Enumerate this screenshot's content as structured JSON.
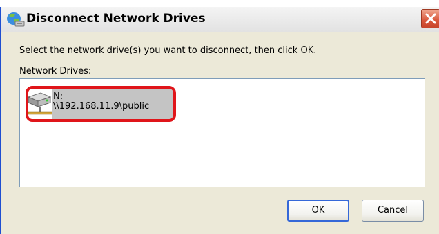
{
  "window": {
    "title": "Disconnect Network Drives"
  },
  "dialog": {
    "instruction": "Select the network drive(s) you want to disconnect, then click OK.",
    "list_label": "Network Drives:",
    "drives": [
      {
        "letter": "N:",
        "path": "\\\\192.168.11.9\\public",
        "selected": true,
        "highlighted": true
      }
    ]
  },
  "buttons": {
    "ok_label": "OK",
    "cancel_label": "Cancel"
  },
  "colors": {
    "window_bg": "#ece9d8",
    "highlight": "#e0151a",
    "selection": "#c4c4c4",
    "close_button": "#d9573b"
  }
}
